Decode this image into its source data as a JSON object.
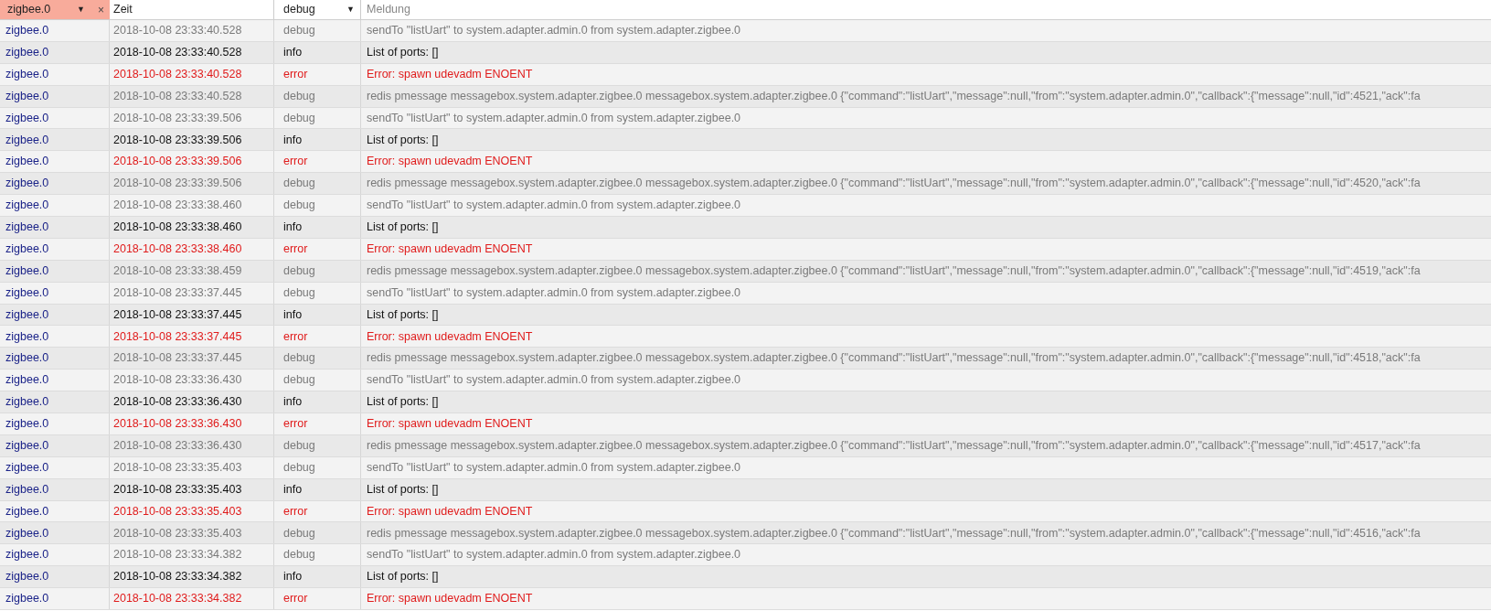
{
  "header": {
    "adapter_filter": {
      "value": "zigbee.0",
      "dropdown": "▼",
      "clear": "×"
    },
    "time_column": "Zeit",
    "level_filter": {
      "value": "debug",
      "dropdown": "▼"
    },
    "message_column": "Meldung"
  },
  "rows": [
    {
      "source": "zigbee.0",
      "time": "2018-10-08 23:33:40.528",
      "kind": "debug",
      "severity": "debug",
      "message": "sendTo \"listUart\" to system.adapter.admin.0 from system.adapter.zigbee.0"
    },
    {
      "source": "zigbee.0",
      "time": "2018-10-08 23:33:40.528",
      "kind": "info",
      "severity": "info",
      "message": "List of ports: []"
    },
    {
      "source": "zigbee.0",
      "time": "2018-10-08 23:33:40.528",
      "kind": "error",
      "severity": "error",
      "message": "Error: spawn udevadm ENOENT"
    },
    {
      "source": "zigbee.0",
      "time": "2018-10-08 23:33:40.528",
      "kind": "debug",
      "severity": "debug",
      "message": "redis pmessage messagebox.system.adapter.zigbee.0 messagebox.system.adapter.zigbee.0 {\"command\":\"listUart\",\"message\":null,\"from\":\"system.adapter.admin.0\",\"callback\":{\"message\":null,\"id\":4521,\"ack\":fa"
    },
    {
      "source": "zigbee.0",
      "time": "2018-10-08 23:33:39.506",
      "kind": "debug",
      "severity": "debug",
      "message": "sendTo \"listUart\" to system.adapter.admin.0 from system.adapter.zigbee.0"
    },
    {
      "source": "zigbee.0",
      "time": "2018-10-08 23:33:39.506",
      "kind": "info",
      "severity": "info",
      "message": "List of ports: []"
    },
    {
      "source": "zigbee.0",
      "time": "2018-10-08 23:33:39.506",
      "kind": "error",
      "severity": "error",
      "message": "Error: spawn udevadm ENOENT"
    },
    {
      "source": "zigbee.0",
      "time": "2018-10-08 23:33:39.506",
      "kind": "debug",
      "severity": "debug",
      "message": "redis pmessage messagebox.system.adapter.zigbee.0 messagebox.system.adapter.zigbee.0 {\"command\":\"listUart\",\"message\":null,\"from\":\"system.adapter.admin.0\",\"callback\":{\"message\":null,\"id\":4520,\"ack\":fa"
    },
    {
      "source": "zigbee.0",
      "time": "2018-10-08 23:33:38.460",
      "kind": "debug",
      "severity": "debug",
      "message": "sendTo \"listUart\" to system.adapter.admin.0 from system.adapter.zigbee.0"
    },
    {
      "source": "zigbee.0",
      "time": "2018-10-08 23:33:38.460",
      "kind": "info",
      "severity": "info",
      "message": "List of ports: []"
    },
    {
      "source": "zigbee.0",
      "time": "2018-10-08 23:33:38.460",
      "kind": "error",
      "severity": "error",
      "message": "Error: spawn udevadm ENOENT"
    },
    {
      "source": "zigbee.0",
      "time": "2018-10-08 23:33:38.459",
      "kind": "debug",
      "severity": "debug",
      "message": "redis pmessage messagebox.system.adapter.zigbee.0 messagebox.system.adapter.zigbee.0 {\"command\":\"listUart\",\"message\":null,\"from\":\"system.adapter.admin.0\",\"callback\":{\"message\":null,\"id\":4519,\"ack\":fa"
    },
    {
      "source": "zigbee.0",
      "time": "2018-10-08 23:33:37.445",
      "kind": "debug",
      "severity": "debug",
      "message": "sendTo \"listUart\" to system.adapter.admin.0 from system.adapter.zigbee.0"
    },
    {
      "source": "zigbee.0",
      "time": "2018-10-08 23:33:37.445",
      "kind": "info",
      "severity": "info",
      "message": "List of ports: []"
    },
    {
      "source": "zigbee.0",
      "time": "2018-10-08 23:33:37.445",
      "kind": "error",
      "severity": "error",
      "message": "Error: spawn udevadm ENOENT"
    },
    {
      "source": "zigbee.0",
      "time": "2018-10-08 23:33:37.445",
      "kind": "debug",
      "severity": "debug",
      "message": "redis pmessage messagebox.system.adapter.zigbee.0 messagebox.system.adapter.zigbee.0 {\"command\":\"listUart\",\"message\":null,\"from\":\"system.adapter.admin.0\",\"callback\":{\"message\":null,\"id\":4518,\"ack\":fa"
    },
    {
      "source": "zigbee.0",
      "time": "2018-10-08 23:33:36.430",
      "kind": "debug",
      "severity": "debug",
      "message": "sendTo \"listUart\" to system.adapter.admin.0 from system.adapter.zigbee.0"
    },
    {
      "source": "zigbee.0",
      "time": "2018-10-08 23:33:36.430",
      "kind": "info",
      "severity": "info",
      "message": "List of ports: []"
    },
    {
      "source": "zigbee.0",
      "time": "2018-10-08 23:33:36.430",
      "kind": "error",
      "severity": "error",
      "message": "Error: spawn udevadm ENOENT"
    },
    {
      "source": "zigbee.0",
      "time": "2018-10-08 23:33:36.430",
      "kind": "debug",
      "severity": "debug",
      "message": "redis pmessage messagebox.system.adapter.zigbee.0 messagebox.system.adapter.zigbee.0 {\"command\":\"listUart\",\"message\":null,\"from\":\"system.adapter.admin.0\",\"callback\":{\"message\":null,\"id\":4517,\"ack\":fa"
    },
    {
      "source": "zigbee.0",
      "time": "2018-10-08 23:33:35.403",
      "kind": "debug",
      "severity": "debug",
      "message": "sendTo \"listUart\" to system.adapter.admin.0 from system.adapter.zigbee.0"
    },
    {
      "source": "zigbee.0",
      "time": "2018-10-08 23:33:35.403",
      "kind": "info",
      "severity": "info",
      "message": "List of ports: []"
    },
    {
      "source": "zigbee.0",
      "time": "2018-10-08 23:33:35.403",
      "kind": "error",
      "severity": "error",
      "message": "Error: spawn udevadm ENOENT"
    },
    {
      "source": "zigbee.0",
      "time": "2018-10-08 23:33:35.403",
      "kind": "debug",
      "severity": "debug",
      "message": "redis pmessage messagebox.system.adapter.zigbee.0 messagebox.system.adapter.zigbee.0 {\"command\":\"listUart\",\"message\":null,\"from\":\"system.adapter.admin.0\",\"callback\":{\"message\":null,\"id\":4516,\"ack\":fa"
    },
    {
      "source": "zigbee.0",
      "time": "2018-10-08 23:33:34.382",
      "kind": "debug",
      "severity": "debug",
      "message": "sendTo \"listUart\" to system.adapter.admin.0 from system.adapter.zigbee.0"
    },
    {
      "source": "zigbee.0",
      "time": "2018-10-08 23:33:34.382",
      "kind": "info",
      "severity": "info",
      "message": "List of ports: []"
    },
    {
      "source": "zigbee.0",
      "time": "2018-10-08 23:33:34.382",
      "kind": "error",
      "severity": "error",
      "message": "Error: spawn udevadm ENOENT"
    }
  ]
}
